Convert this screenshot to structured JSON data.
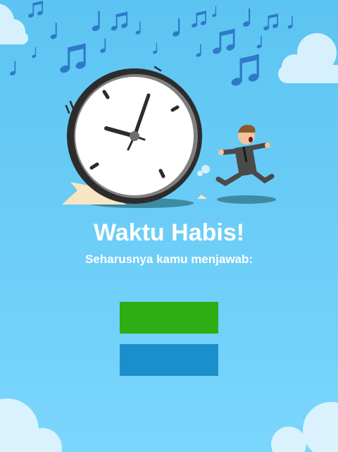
{
  "screen": {
    "title": "Waktu Habis!",
    "subtitle": "Seharusnya kamu menjawab:"
  },
  "answers": [
    {
      "label": "",
      "color": "#2fad12"
    },
    {
      "label": "",
      "color": "#1a8fcb"
    }
  ],
  "colors": {
    "sky_top": "#5ec6f3",
    "sky_bottom": "#78d4fb",
    "note": "#2f79c9",
    "clock_rim": "#2c2c2c",
    "shadow": "#3d8aa3"
  },
  "illustration": {
    "icons": [
      "music-note-icon",
      "clock-icon",
      "running-man-icon",
      "cloud-icon"
    ]
  }
}
